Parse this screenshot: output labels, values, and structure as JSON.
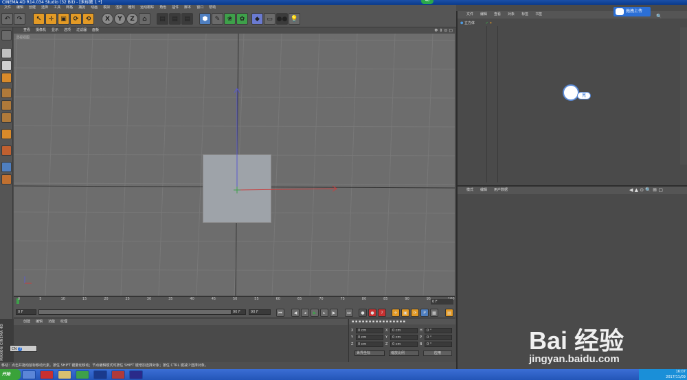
{
  "window": {
    "title": "CINEMA 4D R14.034 Studio (32 Bit) - [未标题 1 *]",
    "badge": "46"
  },
  "menubar": [
    "文件",
    "编辑",
    "创建",
    "选择",
    "工具",
    "网格",
    "捕捉",
    "动画",
    "模拟",
    "渲染",
    "雕刻",
    "运动跟踪",
    "角色",
    "插件",
    "脚本",
    "窗口",
    "帮助"
  ],
  "toolbar": {
    "axis_x": "X",
    "axis_y": "Y",
    "axis_z": "Z"
  },
  "viewport": {
    "menu": [
      "查看",
      "摄像机",
      "显示",
      "选项",
      "过滤器",
      "面板"
    ],
    "label": "透视视图"
  },
  "timeline": {
    "ticks": [
      "0",
      "5",
      "10",
      "15",
      "20",
      "25",
      "30",
      "35",
      "40",
      "45",
      "50",
      "55",
      "60",
      "65",
      "70",
      "75",
      "80",
      "85",
      "90",
      "95",
      "100"
    ],
    "frame_readout": "0 F"
  },
  "transport": {
    "start": "0 F",
    "current": "0 F",
    "end": "90 F",
    "max": "90 F"
  },
  "materials": {
    "menu": [
      "创建",
      "编辑",
      "功能",
      "纹理"
    ],
    "brand": "MAXON CINEMA 4D",
    "lang": "CN"
  },
  "coords": {
    "rows": [
      {
        "a": "X",
        "av": "0 cm",
        "b": "X",
        "bv": "0 cm",
        "c": "H",
        "cv": "0 °"
      },
      {
        "a": "Y",
        "av": "0 cm",
        "b": "Y",
        "bv": "0 cm",
        "c": "P",
        "cv": "0 °"
      },
      {
        "a": "Z",
        "av": "0 cm",
        "b": "Z",
        "bv": "0 cm",
        "c": "B",
        "cv": "0 °"
      }
    ],
    "mode1": "世界坐标",
    "mode2": "缩放比例",
    "apply": "应用"
  },
  "status": "移动：点击并拖动鼠标移动元素。按住 SHIFT 键量化移动；节点编辑模式时按住 SHIFT 键增加选择对象；按住 CTRL 键减少选择对象。",
  "object_manager": {
    "menu": [
      "文件",
      "编辑",
      "查看",
      "对象",
      "标签",
      "书签"
    ],
    "object_name": "立方体"
  },
  "attribute_manager": {
    "menu": [
      "模式",
      "编辑",
      "用户数据"
    ]
  },
  "upload": {
    "label": "拖拽上传"
  },
  "avatar_tag": "亮",
  "taskbar": {
    "start": "开始",
    "time": "16:07",
    "date": "2017/11/09"
  },
  "watermark": {
    "brand": "Bai 经验",
    "url": "jingyan.baidu.com"
  },
  "colors": {
    "accent": "#e39a25",
    "axis_x": "#c84040",
    "axis_y": "#5a5ad0",
    "viewport_bg": "#6d6d6d",
    "cube": "#9ea3a9"
  }
}
